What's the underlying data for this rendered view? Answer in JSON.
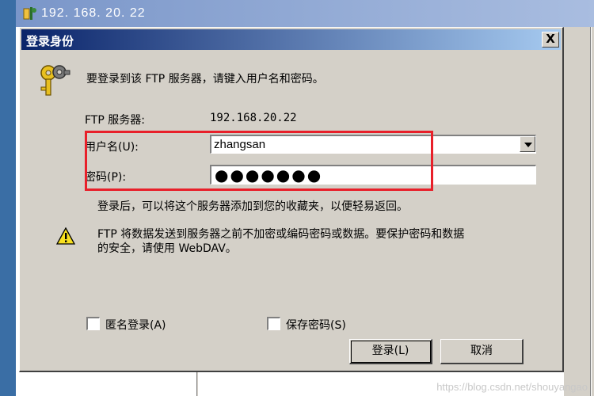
{
  "background_window": {
    "title": "192. 168. 20. 22"
  },
  "dialog": {
    "title": "登录身份",
    "close_label": "X",
    "intro": "要登录到该 FTP 服务器，请键入用户名和密码。",
    "server_label": "FTP 服务器:",
    "server_value": "192.168.20.22",
    "username_label": "用户名(U):",
    "username_value": "zhangsan",
    "password_label": "密码(P):",
    "password_masked": "●●●●●●●",
    "info": "登录后，可以将这个服务器添加到您的收藏夹，以便轻易返回。",
    "warning_line1": "FTP 将数据发送到服务器之前不加密或编码密码或数据。要保护密码和数据",
    "warning_line2": "的安全，请使用 WebDAV。",
    "anonymous_label": "匿名登录(A)",
    "anonymous_checked": false,
    "save_password_label": "保存密码(S)",
    "save_password_checked": false,
    "login_button": "登录(L)",
    "cancel_button": "取消"
  },
  "annotation": {
    "highlight_color": "#e8202a"
  },
  "watermark": "https://blog.csdn.net/shouyangao",
  "colors": {
    "dialog_face": "#d4d0c8",
    "title_gradient_start": "#0a246a",
    "title_gradient_end": "#a6caf0"
  }
}
